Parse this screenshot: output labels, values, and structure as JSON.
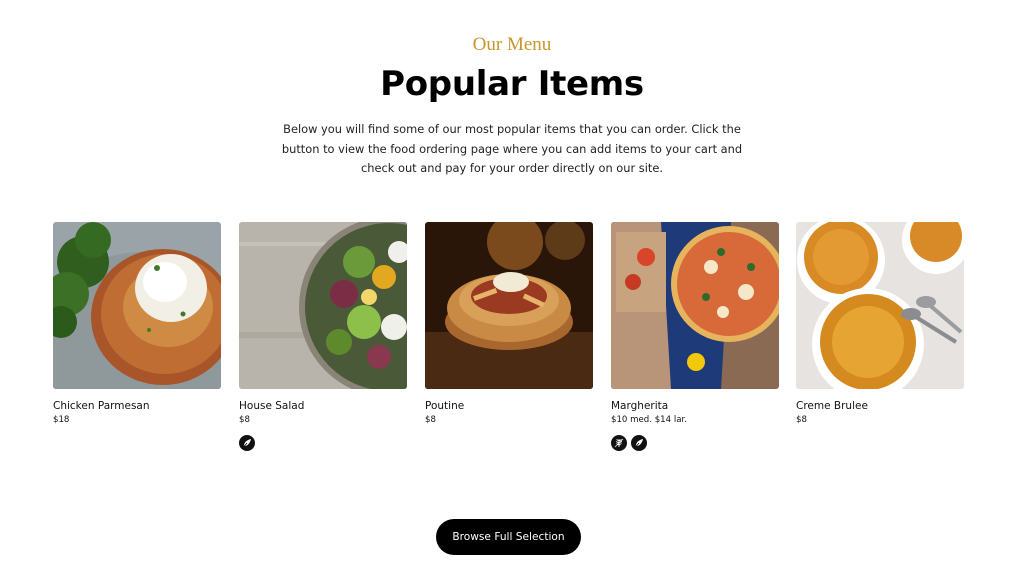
{
  "header": {
    "eyebrow": "Our Menu",
    "title": "Popular Items",
    "intro": "Below you will find some of our most popular items that you can order. Click the button to view the food ordering page where you can add items to your cart and check out and pay for your order directly on our site."
  },
  "menu": {
    "items": [
      {
        "name": "Chicken Parmesan",
        "price": "$18",
        "badges": []
      },
      {
        "name": "House Salad",
        "price": "$8",
        "badges": [
          "leaf-icon"
        ]
      },
      {
        "name": "Poutine",
        "price": "$8",
        "badges": []
      },
      {
        "name": "Margherita",
        "price": "$10 med.  $14 lar.",
        "badges": [
          "wheat-icon",
          "leaf-icon"
        ]
      },
      {
        "name": "Creme Brulee",
        "price": "$8",
        "badges": []
      }
    ]
  },
  "cta": {
    "label": "Browse Full Selection"
  },
  "colors": {
    "accent": "#c9962b",
    "button": "#000000",
    "text": "#111111"
  }
}
